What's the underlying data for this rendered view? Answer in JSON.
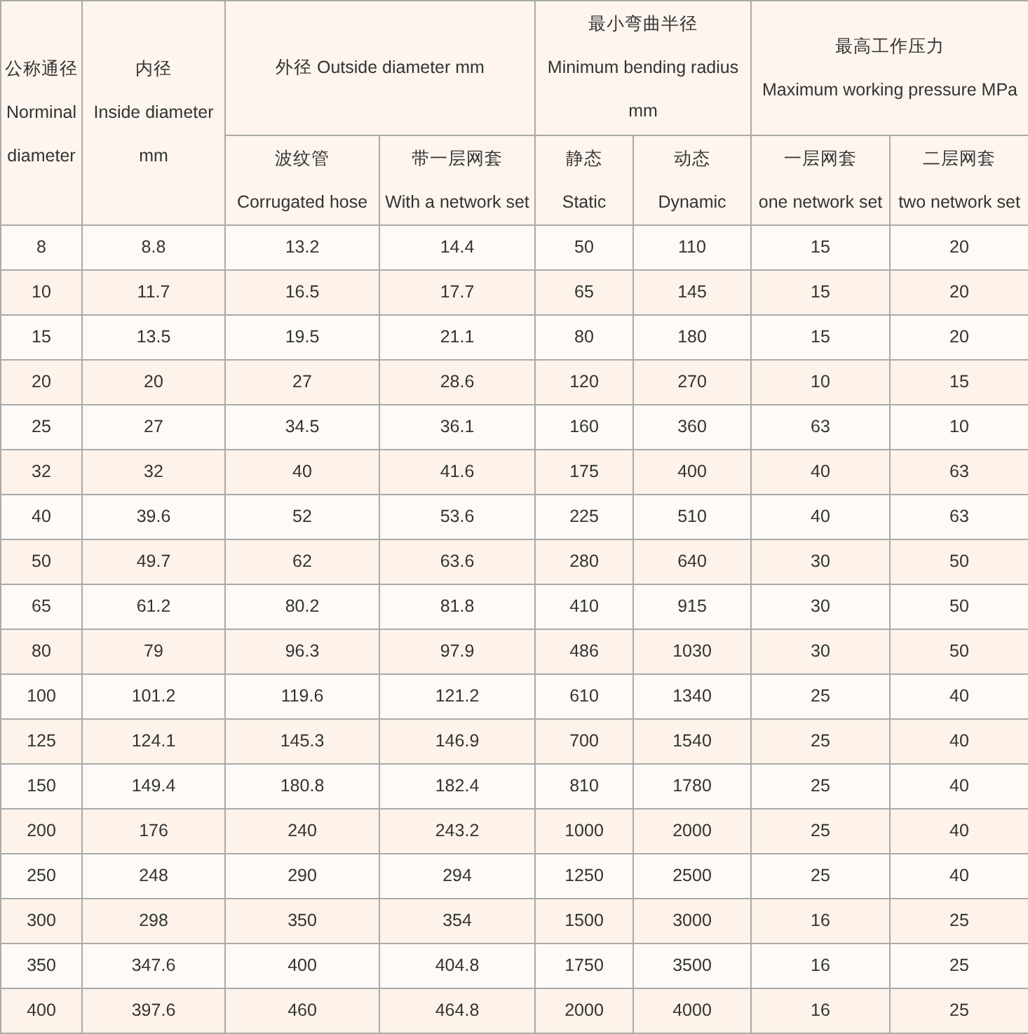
{
  "table": {
    "header_top": [
      {
        "lines": [
          "公称通径",
          "Norminal",
          "diameter"
        ],
        "rowspan": 2
      },
      {
        "lines": [
          "内径",
          "Inside diameter",
          "mm"
        ],
        "rowspan": 2
      },
      {
        "lines": [
          "外径 Outside diameter mm"
        ],
        "colspan": 2
      },
      {
        "lines": [
          "最小弯曲半径",
          "Minimum bending radius",
          "mm"
        ],
        "colspan": 2
      },
      {
        "lines": [
          "最高工作压力",
          "Maximum working pressure MPa"
        ],
        "colspan": 2
      }
    ],
    "header_sub": [
      {
        "lines": [
          "波纹管",
          "Corrugated hose"
        ]
      },
      {
        "lines": [
          "带一层网套",
          "With a network set"
        ]
      },
      {
        "lines": [
          "静态",
          "Static"
        ]
      },
      {
        "lines": [
          "动态",
          "Dynamic"
        ]
      },
      {
        "lines": [
          "一层网套",
          "one network set"
        ]
      },
      {
        "lines": [
          "二层网套",
          "two network set"
        ]
      }
    ],
    "rows": [
      [
        "8",
        "8.8",
        "13.2",
        "14.4",
        "50",
        "110",
        "15",
        "20"
      ],
      [
        "10",
        "11.7",
        "16.5",
        "17.7",
        "65",
        "145",
        "15",
        "20"
      ],
      [
        "15",
        "13.5",
        "19.5",
        "21.1",
        "80",
        "180",
        "15",
        "20"
      ],
      [
        "20",
        "20",
        "27",
        "28.6",
        "120",
        "270",
        "10",
        "15"
      ],
      [
        "25",
        "27",
        "34.5",
        "36.1",
        "160",
        "360",
        "63",
        "10"
      ],
      [
        "32",
        "32",
        "40",
        "41.6",
        "175",
        "400",
        "40",
        "63"
      ],
      [
        "40",
        "39.6",
        "52",
        "53.6",
        "225",
        "510",
        "40",
        "63"
      ],
      [
        "50",
        "49.7",
        "62",
        "63.6",
        "280",
        "640",
        "30",
        "50"
      ],
      [
        "65",
        "61.2",
        "80.2",
        "81.8",
        "410",
        "915",
        "30",
        "50"
      ],
      [
        "80",
        "79",
        "96.3",
        "97.9",
        "486",
        "1030",
        "30",
        "50"
      ],
      [
        "100",
        "101.2",
        "119.6",
        "121.2",
        "610",
        "1340",
        "25",
        "40"
      ],
      [
        "125",
        "124.1",
        "145.3",
        "146.9",
        "700",
        "1540",
        "25",
        "40"
      ],
      [
        "150",
        "149.4",
        "180.8",
        "182.4",
        "810",
        "1780",
        "25",
        "40"
      ],
      [
        "200",
        "176",
        "240",
        "243.2",
        "1000",
        "2000",
        "25",
        "40"
      ],
      [
        "250",
        "248",
        "290",
        "294",
        "1250",
        "2500",
        "25",
        "40"
      ],
      [
        "300",
        "298",
        "350",
        "354",
        "1500",
        "3000",
        "16",
        "25"
      ],
      [
        "350",
        "347.6",
        "400",
        "404.8",
        "1750",
        "3500",
        "16",
        "25"
      ],
      [
        "400",
        "397.6",
        "460",
        "464.8",
        "2000",
        "4000",
        "16",
        "25"
      ]
    ]
  }
}
